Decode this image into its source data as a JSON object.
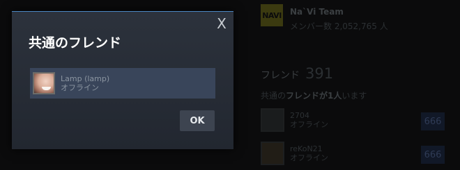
{
  "background": {
    "group": {
      "logo_text": "NAVI",
      "name": "Na`Vi Team",
      "members": "メンバー数 2,052,765 人"
    },
    "friends": {
      "label": "フレンド",
      "count": "391",
      "common_prefix": "共通の",
      "common_bold": "フレンドが1人",
      "common_suffix": "います",
      "items": [
        {
          "name": "2704",
          "status": "オフライン",
          "badge": "666"
        },
        {
          "name": "reKoN21",
          "status": "オフライン",
          "badge": "666"
        }
      ]
    }
  },
  "modal": {
    "title": "共通のフレンド",
    "close_symbol": "X",
    "friend": {
      "name": "Lamp (lamp)",
      "status": "オフライン"
    },
    "ok_label": "OK"
  }
}
